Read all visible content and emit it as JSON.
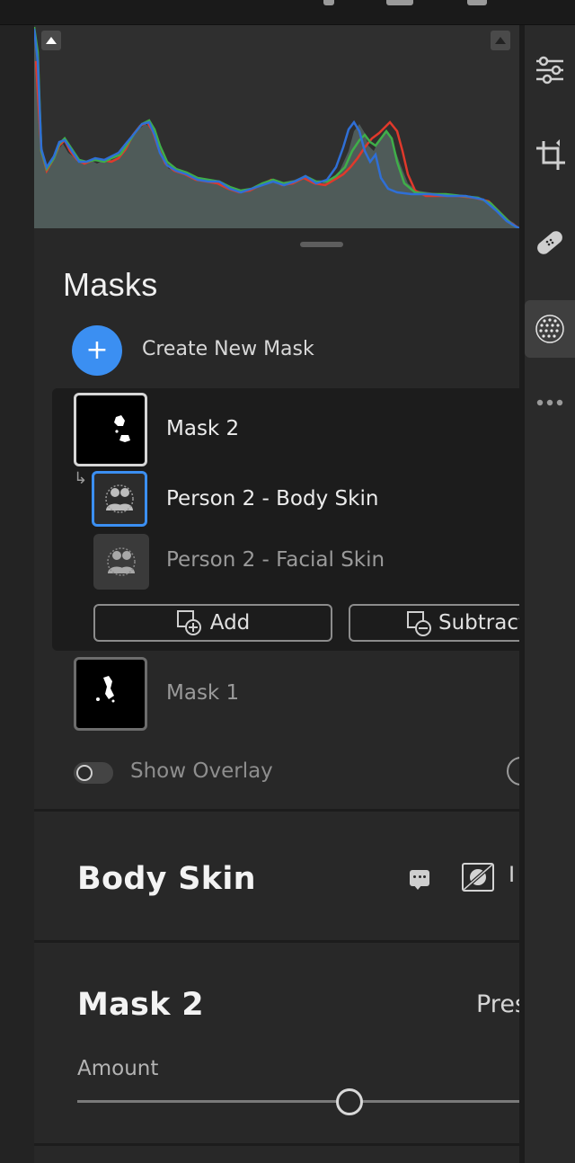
{
  "histogram": {
    "clip_left_label": "shadow-clipping-toggle",
    "clip_right_label": "highlight-clipping-toggle",
    "colors": {
      "red": "#e0392b",
      "green": "#3fae49",
      "blue": "#2f6fd6",
      "fill": "#53605d"
    }
  },
  "masks": {
    "title": "Masks",
    "create_label": "Create New Mask",
    "create_icon": "plus-icon",
    "groups": [
      {
        "name": "Mask 2",
        "components": [
          {
            "label": "Person 2 - Body Skin",
            "icon": "people-icon",
            "selected": true
          },
          {
            "label": "Person 2 - Facial Skin",
            "icon": "people-icon",
            "selected": false
          }
        ],
        "add_label": "Add",
        "subtract_label": "Subtract"
      },
      {
        "name": "Mask 1"
      }
    ],
    "show_overlay_label": "Show Overlay",
    "show_overlay_on": false
  },
  "component_panel": {
    "title": "Body Skin",
    "notes_icon": "comment-icon",
    "invert_icon": "invert-icon",
    "invert_label": "I"
  },
  "mask_panel": {
    "title": "Mask 2",
    "preset_label": "Pres",
    "amount_label": "Amount",
    "amount_position": 0.58
  },
  "tools": [
    {
      "icon": "adjust-sliders-icon",
      "active": false
    },
    {
      "icon": "crop-rotate-icon",
      "active": false
    },
    {
      "icon": "healing-bandage-icon",
      "active": false
    },
    {
      "icon": "masking-icon",
      "active": true
    },
    {
      "icon": "more-icon",
      "active": false
    }
  ],
  "accent": "#3b8ff2"
}
